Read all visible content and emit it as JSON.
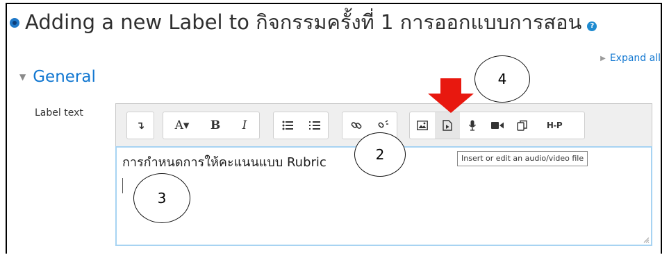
{
  "page": {
    "title": "Adding a new Label to กิจกรรมครั้งที่ 1 การออกแบบการสอน",
    "help_icon": "question-circle-icon"
  },
  "expand_all": {
    "label": "Expand all"
  },
  "section": {
    "title": "General",
    "collapsed": false
  },
  "field": {
    "label": "Label text"
  },
  "toolbar": {
    "buttons": [
      {
        "name": "show-more-buttons",
        "icon": "toolbar-toggle-icon",
        "glyph": "↴"
      },
      {
        "name": "font-style",
        "icon": "font-style-icon",
        "glyph": "A▾"
      },
      {
        "name": "bold",
        "icon": "bold-icon",
        "glyph": "B"
      },
      {
        "name": "italic",
        "icon": "italic-icon",
        "glyph": "I"
      },
      {
        "name": "unordered-list",
        "icon": "bullet-list-icon"
      },
      {
        "name": "ordered-list",
        "icon": "numbered-list-icon"
      },
      {
        "name": "link",
        "icon": "link-icon"
      },
      {
        "name": "unlink",
        "icon": "unlink-icon"
      },
      {
        "name": "image",
        "icon": "image-icon"
      },
      {
        "name": "media",
        "icon": "media-file-icon"
      },
      {
        "name": "record-audio",
        "icon": "microphone-icon"
      },
      {
        "name": "record-video",
        "icon": "video-camera-icon"
      },
      {
        "name": "manage-files",
        "icon": "files-icon"
      },
      {
        "name": "h5p",
        "icon": "h5p-icon",
        "glyph": "H-P"
      }
    ]
  },
  "editor": {
    "content": "การกำหนดการให้คะแนนแบบ Rubric"
  },
  "tooltip": {
    "text": "Insert or edit an audio/video file"
  },
  "annotations": {
    "callout_2": "2",
    "callout_3": "3",
    "callout_4": "4",
    "arrow_color": "#e8180f"
  },
  "colors": {
    "link": "#1177d1",
    "editor_focus_border": "#a7d3f2"
  }
}
